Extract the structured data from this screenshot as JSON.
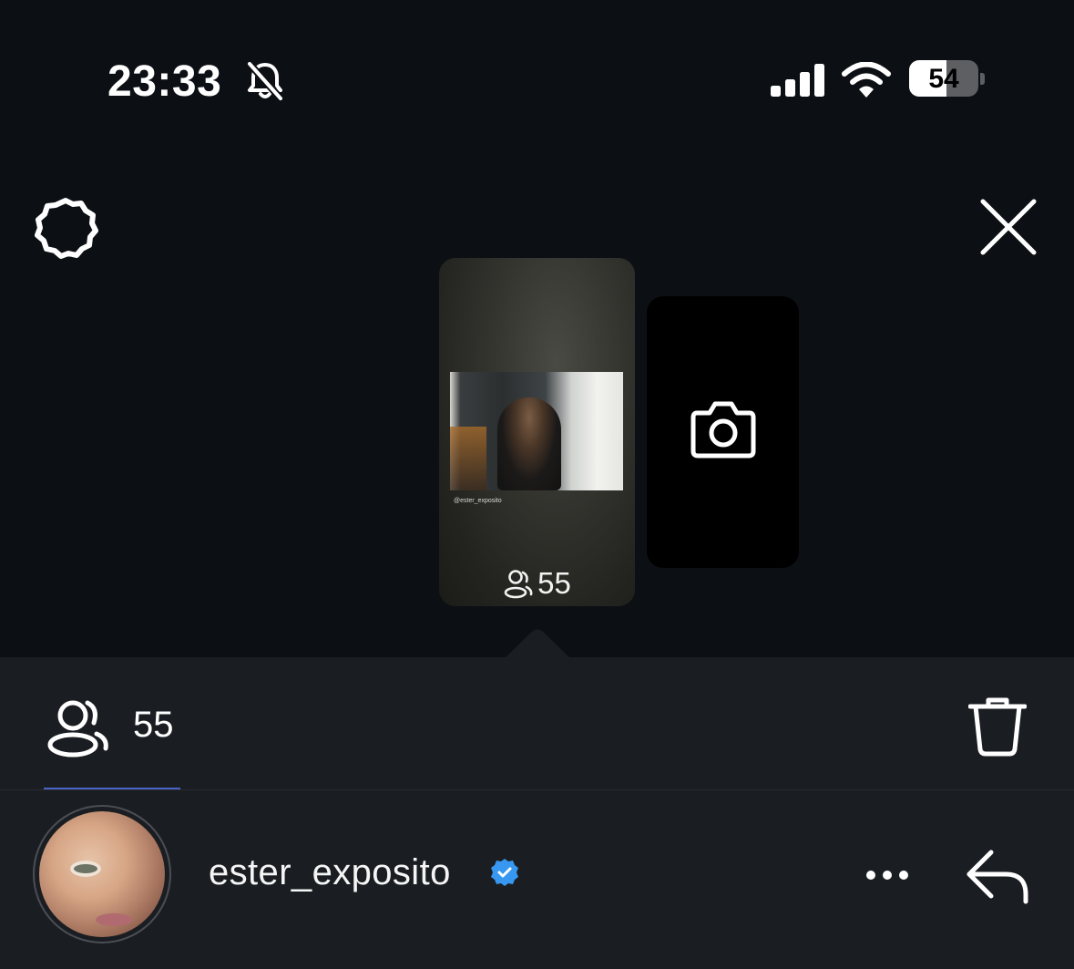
{
  "status_bar": {
    "time": "23:33",
    "battery_level": "54",
    "battery_fraction": 0.54,
    "icons": [
      "bell-muted-icon",
      "cellular-signal-icon",
      "wifi-icon",
      "battery-icon"
    ]
  },
  "top_bar": {
    "icons": [
      "gear-icon",
      "close-icon"
    ]
  },
  "story": {
    "watermark_handle": "@ester_exposito",
    "viewer_count": "55"
  },
  "add_story": {
    "icon": "camera-icon"
  },
  "viewers_panel": {
    "viewer_count": "55",
    "icons": [
      "viewers-icon",
      "trash-icon"
    ],
    "accent_color": "#4a63c7"
  },
  "viewer": {
    "username": "ester_exposito",
    "verified_badge_color": "#3897f0",
    "icons": [
      "verified-badge-icon",
      "more-options-icon",
      "reply-icon"
    ]
  }
}
